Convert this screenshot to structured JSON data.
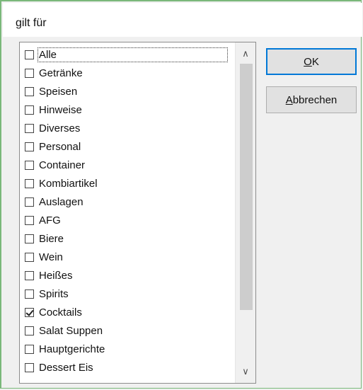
{
  "dialog": {
    "title": "gilt für"
  },
  "list": {
    "items": [
      {
        "label": "Alle",
        "checked": false
      },
      {
        "label": "Getränke",
        "checked": false
      },
      {
        "label": "Speisen",
        "checked": false
      },
      {
        "label": "Hinweise",
        "checked": false
      },
      {
        "label": "Diverses",
        "checked": false
      },
      {
        "label": "Personal",
        "checked": false
      },
      {
        "label": "Container",
        "checked": false
      },
      {
        "label": "Kombiartikel",
        "checked": false
      },
      {
        "label": "Auslagen",
        "checked": false
      },
      {
        "label": "AFG",
        "checked": false
      },
      {
        "label": "Biere",
        "checked": false
      },
      {
        "label": "Wein",
        "checked": false
      },
      {
        "label": "Heißes",
        "checked": false
      },
      {
        "label": "Spirits",
        "checked": false
      },
      {
        "label": "Cocktails",
        "checked": true
      },
      {
        "label": "Salat Suppen",
        "checked": false
      },
      {
        "label": "Hauptgerichte",
        "checked": false
      },
      {
        "label": "Dessert Eis",
        "checked": false
      }
    ]
  },
  "scrollbar": {
    "up_icon": "chevron-up-icon",
    "down_icon": "chevron-down-icon"
  },
  "buttons": {
    "ok": {
      "mnemonic": "O",
      "rest": "K"
    },
    "cancel": {
      "mnemonic": "A",
      "rest": "bbrechen"
    }
  },
  "colors": {
    "window_border": "#7ab87a",
    "default_button_border": "#0078d7"
  }
}
